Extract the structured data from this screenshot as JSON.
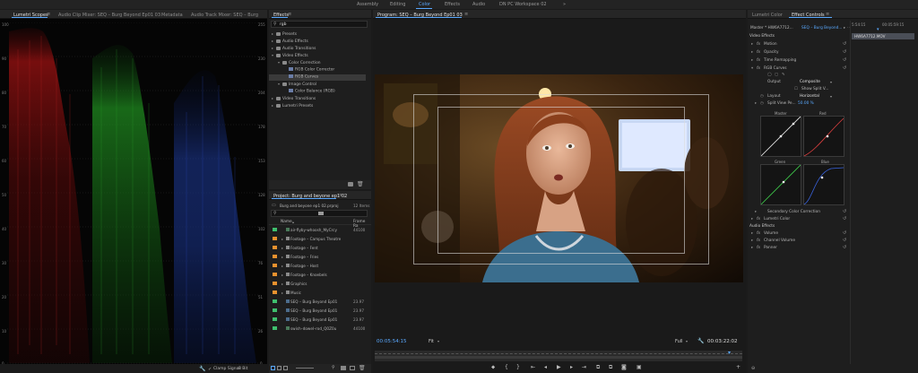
{
  "workspaces": {
    "items": [
      "Assembly",
      "Editing",
      "Color",
      "Effects",
      "Audio",
      "DN PC Workspace 02"
    ],
    "active": "Color",
    "more": "»"
  },
  "scopes": {
    "tabs": [
      "Lumetri Scopes",
      "Audio Clip Mixer: SEQ – Burg Beyond Ep01 03",
      "Metadata",
      "Audio Track Mixer: SEQ – Burg"
    ],
    "menu": "≡",
    "ticks_left": [
      "100",
      "90",
      "80",
      "70",
      "60",
      "50",
      "40",
      "30",
      "20",
      "10",
      "0"
    ],
    "ticks_right": [
      "255",
      "230",
      "204",
      "178",
      "153",
      "128",
      "102",
      "76",
      "51",
      "26",
      "0"
    ],
    "clamp_label": "Clamp Signal",
    "bit_label": "8 Bit"
  },
  "effects": {
    "tab": "Effects",
    "menu": "≡",
    "search_value": "rgb",
    "tree": [
      {
        "label": "Presets",
        "depth": 0,
        "expanded": false
      },
      {
        "label": "Audio Effects",
        "depth": 0,
        "expanded": false
      },
      {
        "label": "Audio Transitions",
        "depth": 0,
        "expanded": false
      },
      {
        "label": "Video Effects",
        "depth": 0,
        "expanded": true
      },
      {
        "label": "Color Correction",
        "depth": 1,
        "expanded": true
      },
      {
        "label": "RGB Color Corrector",
        "depth": 2,
        "effect": true
      },
      {
        "label": "RGB Curves",
        "depth": 2,
        "effect": true,
        "selected": true
      },
      {
        "label": "Image Control",
        "depth": 1,
        "expanded": true
      },
      {
        "label": "Color Balance (RGB)",
        "depth": 2,
        "effect": true
      },
      {
        "label": "Video Transitions",
        "depth": 0,
        "expanded": false
      },
      {
        "label": "Lumetri Presets",
        "depth": 0,
        "expanded": false
      }
    ]
  },
  "project": {
    "tab": "Project: Burg and beyone ep1 02",
    "menu": "≡",
    "file": "Burg and beyone ep1 02.prproj",
    "count": "12 Items",
    "col_name": "Name",
    "col_rate": "Frame Ra",
    "items": [
      {
        "name": "air-flyby-whoosh_MyCrcy",
        "rate": "44100",
        "color": "#3fbf6e",
        "kind": "audio"
      },
      {
        "name": "Footage – Campus Theatre",
        "rate": "",
        "color": "#e8912e",
        "kind": "bin"
      },
      {
        "name": "Footage – Fent",
        "rate": "",
        "color": "#e8912e",
        "kind": "bin"
      },
      {
        "name": "Footage – Fries",
        "rate": "",
        "color": "#e8912e",
        "kind": "bin"
      },
      {
        "name": "Footage – Host",
        "rate": "",
        "color": "#e8912e",
        "kind": "bin"
      },
      {
        "name": "Footage – Knoebels",
        "rate": "",
        "color": "#e8912e",
        "kind": "bin"
      },
      {
        "name": "Graphics",
        "rate": "",
        "color": "#e8912e",
        "kind": "bin"
      },
      {
        "name": "Music",
        "rate": "",
        "color": "#e8912e",
        "kind": "bin"
      },
      {
        "name": "SEQ – Burg Beyond Ep01",
        "rate": "23.97",
        "color": "#3fbf6e",
        "kind": "seq"
      },
      {
        "name": "SEQ – Burg Beyond Ep01",
        "rate": "23.97",
        "color": "#3fbf6e",
        "kind": "seq"
      },
      {
        "name": "SEQ – Burg Beyond Ep01",
        "rate": "23.97",
        "color": "#3fbf6e",
        "kind": "seq"
      },
      {
        "name": "swish–dowel–rod_Q0Z0u",
        "rate": "44100",
        "color": "#3fbf6e",
        "kind": "audio"
      }
    ]
  },
  "program": {
    "tab": "Program: SEQ – Burg Beyond Ep01 03",
    "menu": "≡",
    "timecode_in": "00:05:54:15",
    "fit": "Fit",
    "quality": "Full",
    "timecode_dur": "00:03:22:02"
  },
  "fxcontrols": {
    "tabs": [
      "Lumetri Color",
      "Effect Controls"
    ],
    "menu": "≡",
    "master": "Master * HW6A7712...",
    "seq": "SEQ – Burg Beyond...",
    "time_a": "5:54:15",
    "time_b": "00:05:59:15",
    "clip": "HW6A7712.MOV",
    "rows": [
      {
        "label": "Video Effects",
        "kind": "header"
      },
      {
        "label": "Motion",
        "kind": "fx"
      },
      {
        "label": "Opacity",
        "kind": "fx"
      },
      {
        "label": "Time Remapping",
        "kind": "fx"
      },
      {
        "label": "RGB Curves",
        "kind": "fx-open"
      }
    ],
    "output_label": "Output",
    "output_value": "Composite",
    "split_label": "Show Split V...",
    "layout_label": "Layout",
    "layout_value": "Horizontal",
    "split_pct_label": "Split View Pe...",
    "split_pct_value": "50.00 %",
    "curves": [
      "Master",
      "Red",
      "Green",
      "Blue"
    ],
    "lower_rows": [
      {
        "label": "Secondary Color Correction",
        "kind": "sub"
      },
      {
        "label": "Lumetri Color",
        "kind": "fx"
      },
      {
        "label": "Audio Effects",
        "kind": "header"
      },
      {
        "label": "Volume",
        "kind": "fx"
      },
      {
        "label": "Channel Volume",
        "kind": "fx"
      },
      {
        "label": "Panner",
        "kind": "fx"
      }
    ]
  }
}
